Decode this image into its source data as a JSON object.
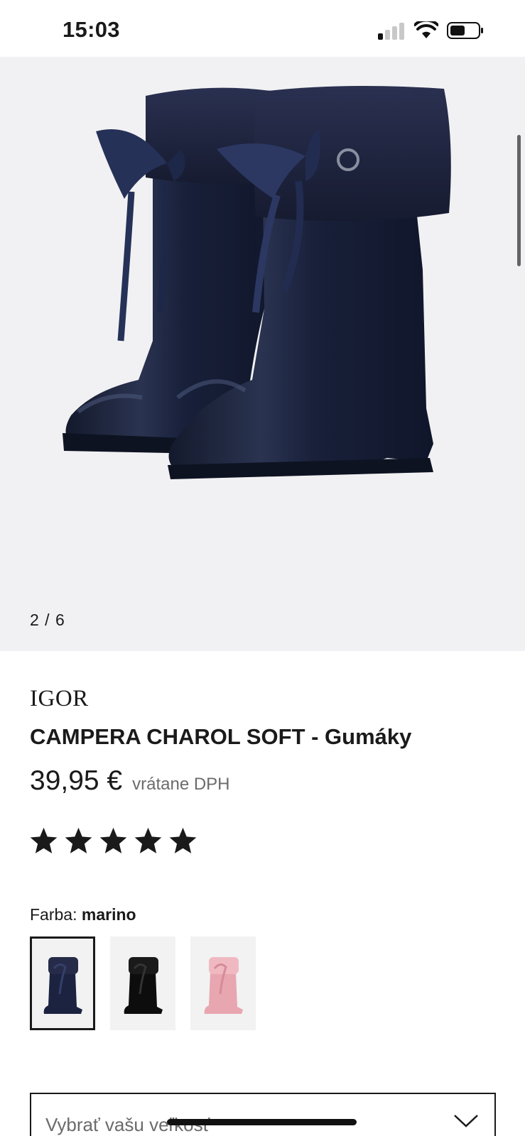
{
  "status_bar": {
    "time": "15:03"
  },
  "gallery": {
    "counter": "2 / 6"
  },
  "product": {
    "brand": "IGOR",
    "title": "CAMPERA CHAROL SOFT - Gumáky",
    "price": "39,95 €",
    "price_note": "vrátane DPH",
    "rating_stars": 5
  },
  "color": {
    "label": "Farba:",
    "selected": "marino",
    "swatches": [
      {
        "name": "marino",
        "color": "#1c2340"
      },
      {
        "name": "black",
        "color": "#0d0d0d"
      },
      {
        "name": "pink",
        "color": "#e8a6b0"
      }
    ]
  },
  "size_select": {
    "placeholder": "Vybrať vašu veľkosť"
  },
  "colors": {
    "boot": "#1b2238",
    "fur": "#1f2440",
    "bow": "#2a3560",
    "background": "#f1f1f3"
  }
}
